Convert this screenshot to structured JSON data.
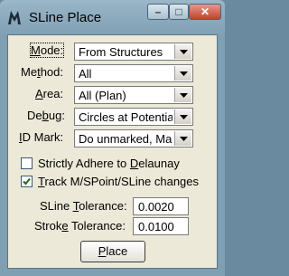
{
  "window": {
    "title": "SLine Place",
    "icon": "bentley-m-icon"
  },
  "titlebar": {
    "minimize_glyph": "–",
    "maximize_glyph": "□",
    "close_glyph": "✕"
  },
  "form": {
    "mode": {
      "label_pre": "",
      "label_ul": "M",
      "label_post": "ode:",
      "value": "From Structures"
    },
    "method": {
      "label_pre": "Me",
      "label_ul": "t",
      "label_post": "hod:",
      "value": "All"
    },
    "area": {
      "label_pre": "",
      "label_ul": "A",
      "label_post": "rea:",
      "value": "All (Plan)"
    },
    "debug": {
      "label_pre": "De",
      "label_ul": "b",
      "label_post": "ug:",
      "value": "Circles at Potentia"
    },
    "id_mark": {
      "label_pre": "",
      "label_ul": "I",
      "label_post": "D Mark:",
      "value": "Do unmarked, Ma"
    }
  },
  "checks": {
    "strict": {
      "label_pre": "Strictly Adhere to ",
      "label_ul": "D",
      "label_post": "elaunay",
      "checked": false
    },
    "track": {
      "label_pre": "",
      "label_ul": "T",
      "label_post": "rack M/SPoint/SLine changes",
      "checked": true
    }
  },
  "fields": {
    "sline_tolerance": {
      "label_pre": "SLine ",
      "label_ul": "T",
      "label_post": "olerance:",
      "value": "0.0020"
    },
    "stroke_tolerance": {
      "label_pre": "Strok",
      "label_ul": "e",
      "label_post": " Tolerance:",
      "value": "0.0100"
    }
  },
  "actions": {
    "place": {
      "label_pre": "",
      "label_ul": "P",
      "label_post": "lace"
    }
  }
}
